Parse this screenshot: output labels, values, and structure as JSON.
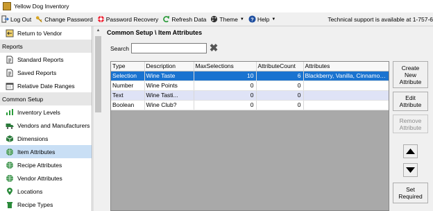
{
  "window": {
    "title": "Yellow Dog Inventory"
  },
  "toolbar": {
    "items": [
      {
        "label": "Log Out",
        "icon": "logout-icon"
      },
      {
        "label": "Change Password",
        "icon": "key-icon"
      },
      {
        "label": "Password Recovery",
        "icon": "lifebuoy-icon"
      },
      {
        "label": "Refresh Data",
        "icon": "refresh-icon"
      },
      {
        "label": "Theme",
        "icon": "palette-icon"
      },
      {
        "label": "Help",
        "icon": "help-icon"
      }
    ],
    "support_text": "Technical support is available at 1-757-6"
  },
  "sidebar": {
    "entries": [
      {
        "kind": "item",
        "label": "Return to Vendor",
        "icon": "return-icon"
      },
      {
        "kind": "header",
        "label": "Reports"
      },
      {
        "kind": "item",
        "label": "Standard Reports",
        "icon": "report-icon"
      },
      {
        "kind": "item",
        "label": "Saved Reports",
        "icon": "report-icon"
      },
      {
        "kind": "item",
        "label": "Relative Date Ranges",
        "icon": "calendar-icon"
      },
      {
        "kind": "header",
        "label": "Common Setup"
      },
      {
        "kind": "item",
        "label": "Inventory Levels",
        "icon": "levels-icon"
      },
      {
        "kind": "item",
        "label": "Vendors and Manufacturers",
        "icon": "truck-icon"
      },
      {
        "kind": "item",
        "label": "Dimensions",
        "icon": "box-icon"
      },
      {
        "kind": "item",
        "label": "Item Attributes",
        "icon": "globe-icon",
        "selected": true
      },
      {
        "kind": "item",
        "label": "Recipe Attributes",
        "icon": "globe-icon"
      },
      {
        "kind": "item",
        "label": "Vendor Attributes",
        "icon": "globe-icon"
      },
      {
        "kind": "item",
        "label": "Locations",
        "icon": "location-icon"
      },
      {
        "kind": "item",
        "label": "Recipe Types",
        "icon": "recipe-icon"
      }
    ]
  },
  "main": {
    "title": "Common Setup \\ Item Attributes",
    "search": {
      "label": "Search",
      "value": "",
      "placeholder": ""
    },
    "grid": {
      "columns": [
        "Type",
        "Description",
        "MaxSelections",
        "AttributeCount",
        "Attributes"
      ],
      "rows": [
        {
          "cells": [
            "Selection",
            "Wine Taste",
            "10",
            "6",
            "Blackberry, Vanilla, Cinnamon, To"
          ],
          "selected": true
        },
        {
          "cells": [
            "Number",
            "Wine Points",
            "0",
            "0",
            ""
          ]
        },
        {
          "cells": [
            "Text",
            "Wine Tasti...",
            "0",
            "0",
            ""
          ]
        },
        {
          "cells": [
            "Boolean",
            "Wine Club?",
            "0",
            "0",
            ""
          ]
        }
      ]
    },
    "buttons": {
      "create": "Create\nNew\nAttribute",
      "edit": "Edit\nAttribute",
      "remove": "Remove\nAttribute",
      "set_required": "Set\nRequired"
    }
  },
  "colors": {
    "selection": "#1a73d0",
    "alt_row": "#dfe3f6",
    "sidebar_selected": "#c9dff5"
  }
}
